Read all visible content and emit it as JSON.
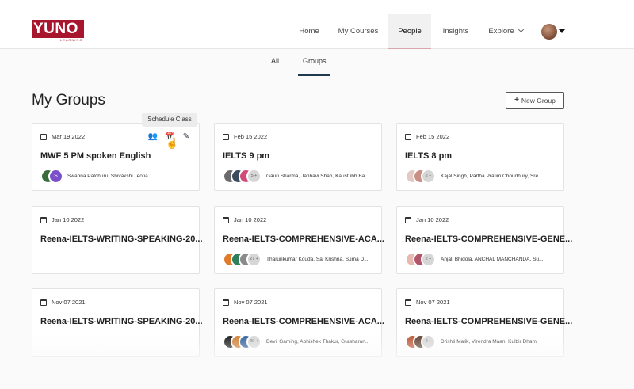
{
  "brand": {
    "logo_text": "YUNO",
    "logo_sub": "LEARNING",
    "color": "#a8162d"
  },
  "nav": {
    "home": "Home",
    "my_courses": "My Courses",
    "people": "People",
    "insights": "Insights",
    "explore": "Explore"
  },
  "subtabs": {
    "all": "All",
    "groups": "Groups"
  },
  "page_title": "My Groups",
  "new_group_label": "New Group",
  "tooltip": "Schedule Class",
  "cards": [
    {
      "date": "Mar 19 2022",
      "title": "MWF 5 PM spoken English",
      "names": "Swapna Patchuru, Shivakshi Teotia",
      "more": ""
    },
    {
      "date": "Feb 15 2022",
      "title": "IELTS 9 pm",
      "names": "Gauri Sharma, Janhavi Shah, Kaustubh Ba...",
      "more": "5 +"
    },
    {
      "date": "Feb 15 2022",
      "title": "IELTS 8 pm",
      "names": "Kajal Singh, Partha Pratim Choudhury, Sre...",
      "more": "2 +"
    },
    {
      "date": "Jan 10 2022",
      "title": "Reena-IELTS-WRITING-SPEAKING-20...",
      "names": "",
      "more": ""
    },
    {
      "date": "Jan 10 2022",
      "title": "Reena-IELTS-COMPREHENSIVE-ACA...",
      "names": "Tharunkumar Kouda, Sai Krishna, Suma D...",
      "more": "27 +"
    },
    {
      "date": "Jan 10 2022",
      "title": "Reena-IELTS-COMPREHENSIVE-GENE...",
      "names": "Anjali Bhidola, ANCHAL MANCHANDA, Su...",
      "more": "2 +"
    },
    {
      "date": "Nov 07 2021",
      "title": "Reena-IELTS-WRITING-SPEAKING-20...",
      "names": "",
      "more": ""
    },
    {
      "date": "Nov 07 2021",
      "title": "Reena-IELTS-COMPREHENSIVE-ACA...",
      "names": "Devil Gaming, Abhishek Thakur, Gursharan...",
      "more": "30 +"
    },
    {
      "date": "Nov 07 2021",
      "title": "Reena-IELTS-COMPREHENSIVE-GENE...",
      "names": "Drishti Malik, Virendra Maan, Kulbir Dhami",
      "more": "2 +"
    }
  ],
  "avatar_initial": "S"
}
